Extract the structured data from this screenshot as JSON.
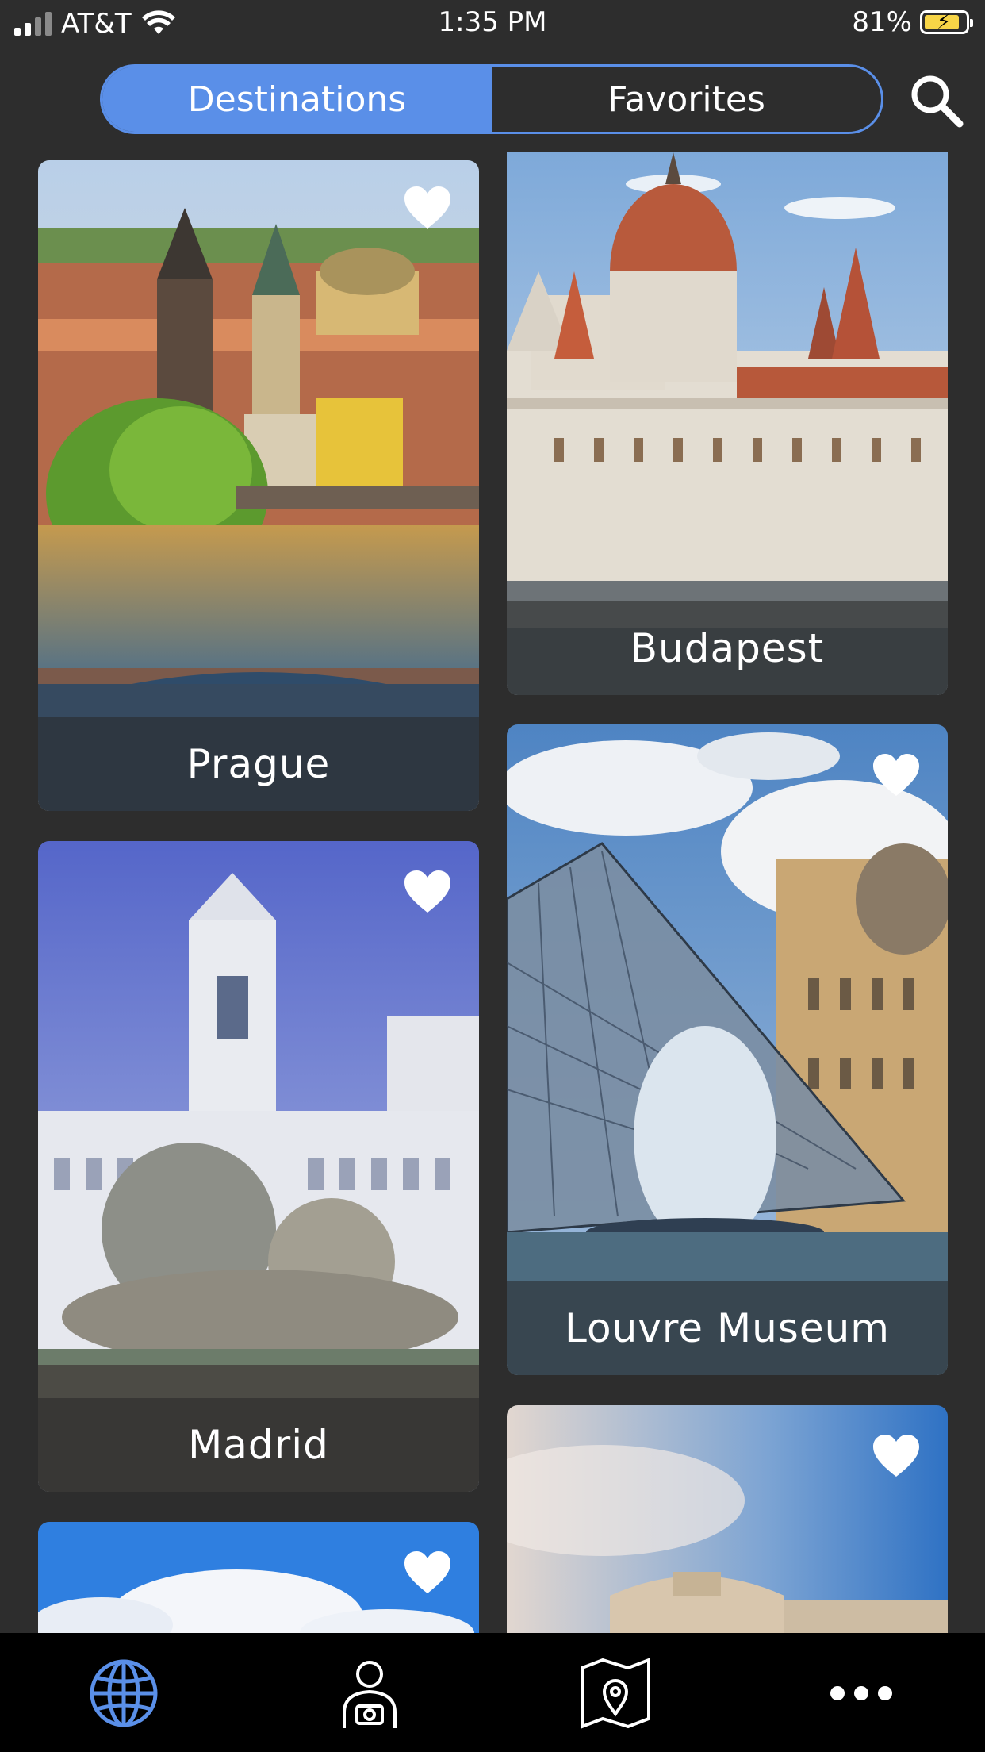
{
  "status": {
    "carrier": "AT&T",
    "time": "1:35 PM",
    "battery": "81%"
  },
  "segment": {
    "tabs": [
      "Destinations",
      "Favorites"
    ],
    "active": 0
  },
  "cards": [
    {
      "name": "Prague",
      "favorited": true
    },
    {
      "name": "Budapest",
      "favorited": false
    },
    {
      "name": "Madrid",
      "favorited": true
    },
    {
      "name": "Louvre Museum",
      "favorited": true
    },
    {
      "name": "",
      "favorited": true
    },
    {
      "name": "",
      "favorited": true
    }
  ],
  "tabbar": {
    "items": [
      "globe-icon",
      "photographer-icon",
      "map-pin-icon",
      "more-icon"
    ],
    "active_color": "#5a8fe8"
  }
}
